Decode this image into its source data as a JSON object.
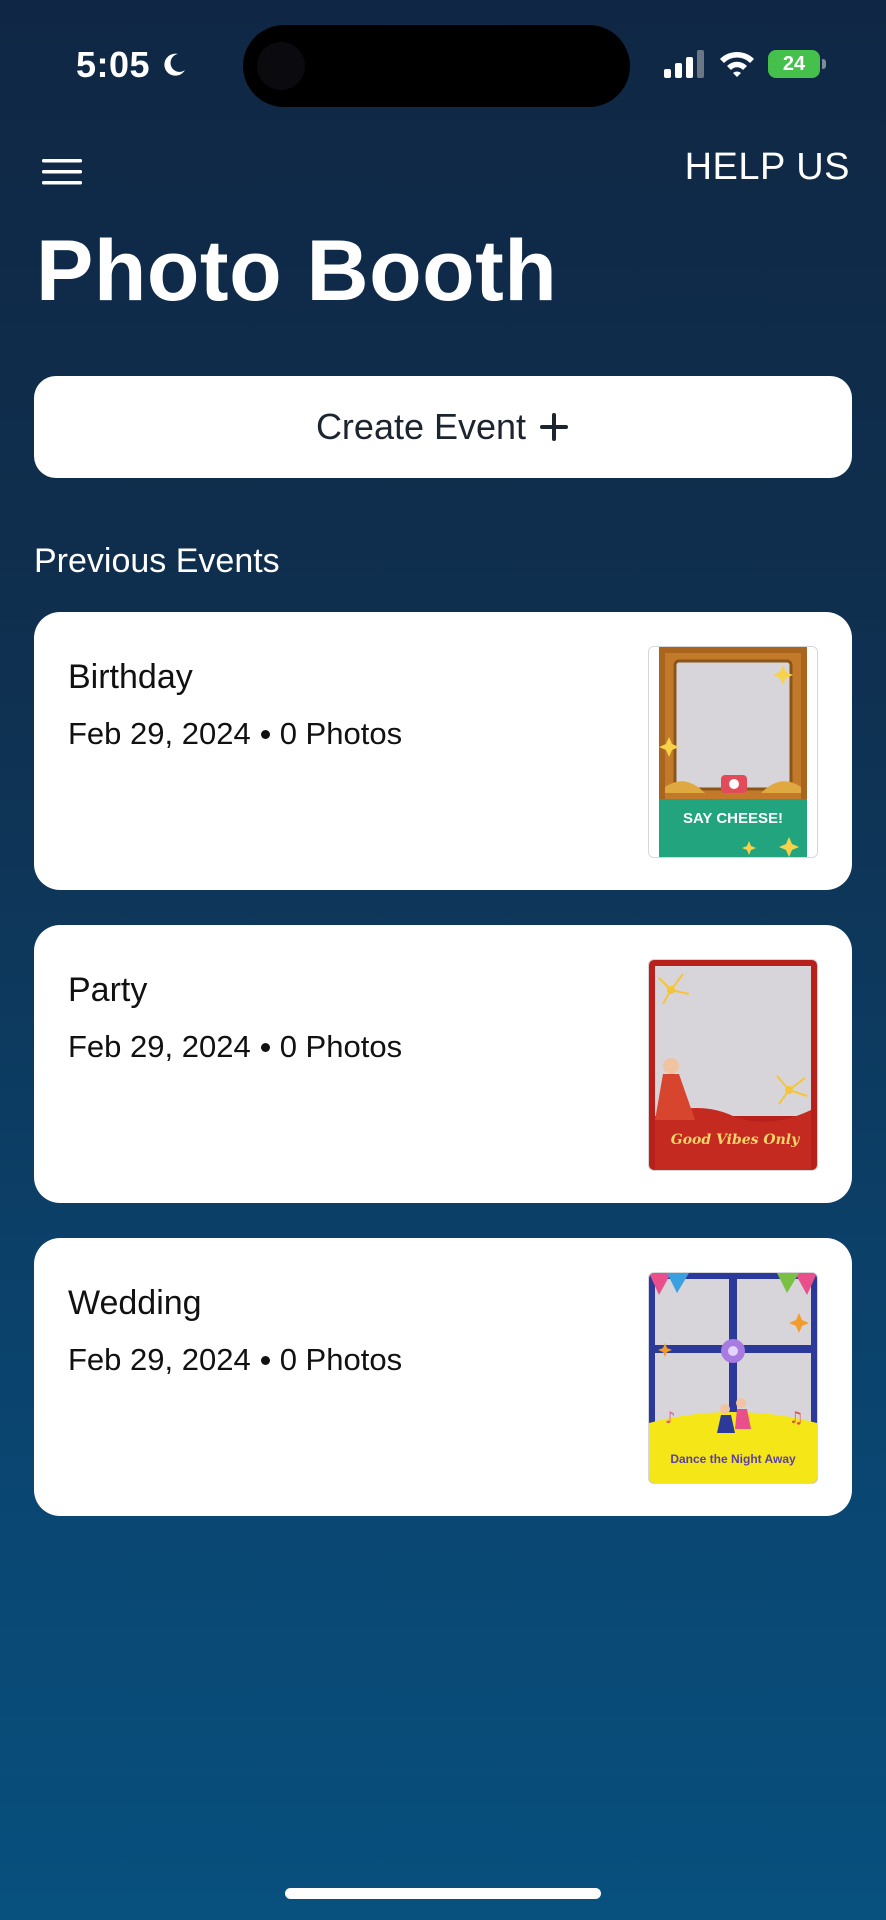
{
  "status_bar": {
    "time": "5:05",
    "battery": "24",
    "icons": [
      "moon-icon",
      "signal-icon",
      "wifi-icon",
      "battery-icon"
    ]
  },
  "header": {
    "help_label": "HELP US",
    "title": "Photo Booth"
  },
  "create_event": {
    "label": "Create Event"
  },
  "previous_events": {
    "label": "Previous Events",
    "events": [
      {
        "name": "Birthday",
        "date": "Feb 29, 2024",
        "photos": "0 Photos",
        "frame_text": "SAY CHEESE!"
      },
      {
        "name": "Party",
        "date": "Feb 29, 2024",
        "photos": "0 Photos",
        "frame_text": "Good Vibes Only"
      },
      {
        "name": "Wedding",
        "date": "Feb 29, 2024",
        "photos": "0 Photos",
        "frame_text": "Dance the Night Away"
      }
    ]
  },
  "colors": {
    "background_top": "#0f2744",
    "background_bottom": "#08507e",
    "card": "#ffffff",
    "text_dark": "#111111",
    "battery": "#45c04a"
  }
}
